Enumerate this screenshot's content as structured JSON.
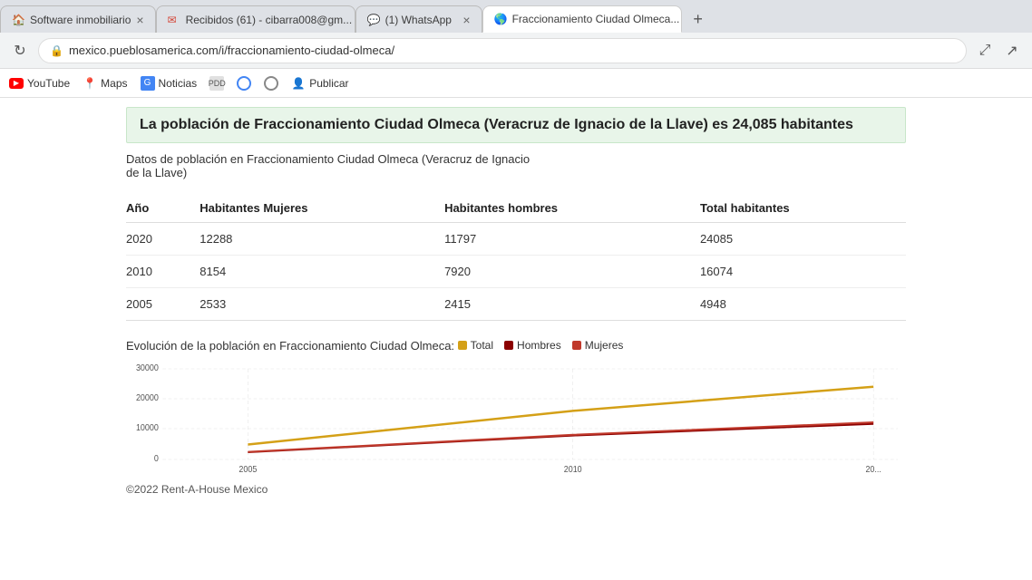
{
  "browser": {
    "tabs": [
      {
        "id": "tab-1",
        "label": "Software inmobiliario",
        "active": false,
        "favicon": "🏠"
      },
      {
        "id": "tab-2",
        "label": "Recibidos (61) - cibarra008@gm...",
        "active": false,
        "favicon": "✉"
      },
      {
        "id": "tab-3",
        "label": "(1) WhatsApp",
        "active": false,
        "favicon": "💬"
      },
      {
        "id": "tab-4",
        "label": "Fraccionamiento Ciudad Olmeca...",
        "active": true,
        "favicon": "🌎"
      }
    ],
    "url": "mexico.pueblosamerica.com/i/fraccionamiento-ciudad-olmeca/",
    "bookmarks": [
      {
        "id": "bm-youtube",
        "label": "YouTube",
        "type": "youtube"
      },
      {
        "id": "bm-maps",
        "label": "Maps",
        "type": "maps"
      },
      {
        "id": "bm-noticias",
        "label": "Noticias",
        "type": "noticias"
      },
      {
        "id": "bm-pdd",
        "label": "PDD",
        "type": "pdd"
      },
      {
        "id": "bm-5",
        "label": "",
        "type": "circle"
      },
      {
        "id": "bm-6",
        "label": "",
        "type": "circle2"
      },
      {
        "id": "bm-publicar",
        "label": "Publicar",
        "type": "person"
      }
    ]
  },
  "page": {
    "main_title": "La población de Fraccionamiento Ciudad Olmeca (Veracruz de Ignacio de la Llave) es 24,085 habitantes",
    "subtitle_line1": "Datos de población en Fraccionamiento Ciudad Olmeca (Veracruz de Ignacio",
    "subtitle_line2": "de la Llave)",
    "table": {
      "headers": [
        "Año",
        "Habitantes Mujeres",
        "Habitantes hombres",
        "Total habitantes"
      ],
      "rows": [
        {
          "year": "2020",
          "mujeres": "12288",
          "hombres": "11797",
          "total": "24085"
        },
        {
          "year": "2010",
          "mujeres": "8154",
          "hombres": "7920",
          "total": "16074"
        },
        {
          "year": "2005",
          "mujeres": "2533",
          "hombres": "2415",
          "total": "4948"
        }
      ]
    },
    "chart": {
      "title": "Evolución de la población en Fraccionamiento Ciudad Olmeca:",
      "legend": [
        {
          "label": "Total",
          "color": "#d4a017"
        },
        {
          "label": "Hombres",
          "color": "#8b0000"
        },
        {
          "label": "Mujeres",
          "color": "#c0392b"
        }
      ],
      "y_labels": [
        "30000",
        "20000",
        "10000",
        "0"
      ],
      "x_labels": [
        "2005",
        "2010",
        "20..."
      ],
      "data_total": [
        4948,
        16074,
        24085
      ],
      "data_hombres": [
        2415,
        7920,
        11797
      ],
      "data_mujeres": [
        2533,
        8154,
        12288
      ],
      "y_max": 30000,
      "years": [
        2005,
        2010,
        2020
      ]
    },
    "footer": "©2022 Rent-A-House Mexico"
  }
}
